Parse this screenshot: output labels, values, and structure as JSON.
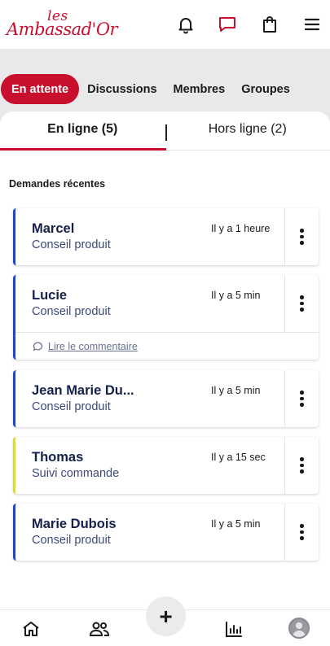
{
  "brand": {
    "logo_top": "les",
    "logo_main": "Ambassad'Or",
    "color": "#c8102e"
  },
  "header": {
    "icons": [
      "bell-icon",
      "chat-icon",
      "shopping-bag-icon",
      "menu-icon"
    ]
  },
  "filters": {
    "items": [
      {
        "label": "En attente",
        "active": true
      },
      {
        "label": "Discussions",
        "active": false
      },
      {
        "label": "Membres",
        "active": false
      },
      {
        "label": "Groupes",
        "active": false
      }
    ]
  },
  "tabs": [
    {
      "label": "En ligne (5)",
      "active": true
    },
    {
      "label": "Hors ligne (2)",
      "active": false
    }
  ],
  "section_title": "Demandes récentes",
  "requests": [
    {
      "name": "Marcel",
      "topic": "Conseil produit",
      "time": "Il y a 1 heure",
      "accent": "#2046c8"
    },
    {
      "name": "Lucie",
      "topic": "Conseil produit",
      "time": "Il y a 5 min",
      "accent": "#2046c8",
      "comment_link": "Lire le commentaire"
    },
    {
      "name": "Jean Marie Du...",
      "topic": "Conseil produit",
      "time": "Il y a 5 min",
      "accent": "#2046c8"
    },
    {
      "name": "Thomas",
      "topic": "Suivi commande",
      "time": "Il y a 15 sec",
      "accent": "#d8de2a"
    },
    {
      "name": "Marie Dubois",
      "topic": "Conseil produit",
      "time": "Il y a 5 min",
      "accent": "#2046c8"
    }
  ],
  "bottom_nav": {
    "items": [
      "home-icon",
      "people-icon",
      "add-button",
      "stats-icon",
      "avatar"
    ],
    "fab_label": "+"
  }
}
